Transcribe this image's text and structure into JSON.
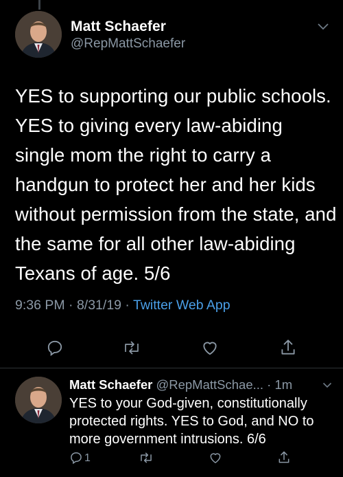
{
  "tweet1": {
    "name": "Matt Schaefer",
    "handle": "@RepMattSchaefer",
    "text": "YES to supporting our public schools. YES to giving every law-abiding single mom the right to carry a handgun to protect her and her kids without permission from the state, and the same for all other law-abiding Texans of age. 5/6",
    "timestamp": "9:36 PM · 8/31/19 · ",
    "source": "Twitter Web App"
  },
  "tweet2": {
    "name": "Matt Schaefer",
    "handle": "@RepMattSchae...",
    "separator": " · ",
    "time": "1m",
    "text": "YES to your God-given, constitutionally protected rights. YES to God, and NO to more government intrusions. 6/6",
    "reply_count": "1"
  },
  "icons": {
    "reply": "reply-icon",
    "retweet": "retweet-icon",
    "like": "like-icon",
    "share": "share-icon",
    "more": "chevron-down-icon"
  },
  "colors": {
    "background": "#000000",
    "text": "#ffffff",
    "secondary": "#8b98a5",
    "link": "#4a9fe8"
  }
}
